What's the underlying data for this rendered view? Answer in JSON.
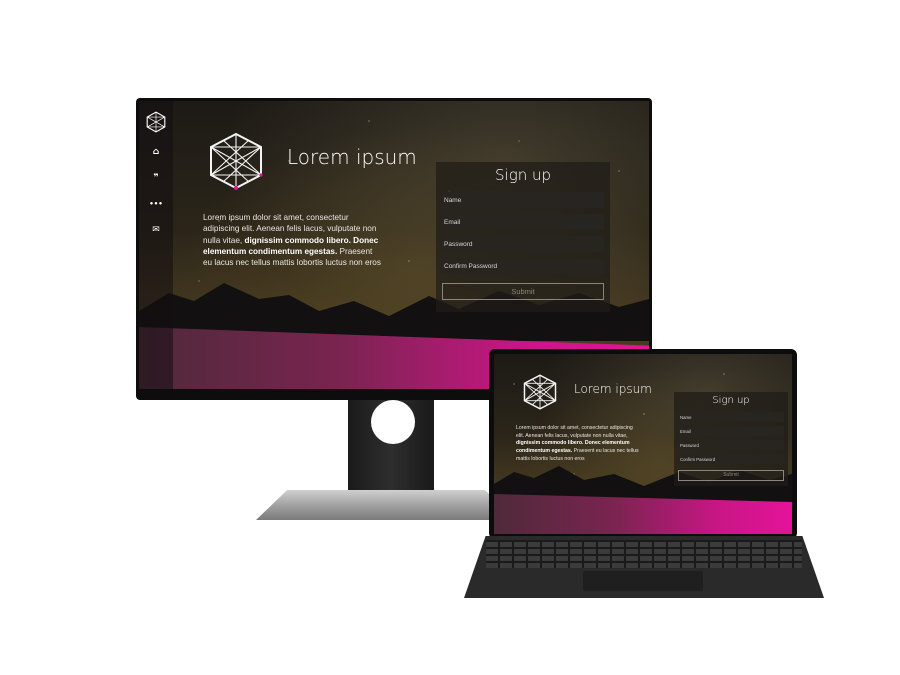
{
  "colors": {
    "accent_magenta": "#e4139a",
    "accent_purple": "#7a2450",
    "sidebar_bg": "#140e12",
    "form_bg": "#1e1c18"
  },
  "sidebar": {
    "items": [
      {
        "icon": "home-icon",
        "glyph": "⌂"
      },
      {
        "icon": "quote-icon",
        "glyph": "❞"
      },
      {
        "icon": "more-icon",
        "glyph": "•••"
      },
      {
        "icon": "mail-icon",
        "glyph": "✉"
      }
    ]
  },
  "hero": {
    "title": "Lorem ipsum",
    "text_1": "Lorem ipsum dolor sit amet, consectetur adipiscing elit. Aenean felis lacus, vulputate non nulla vitae,",
    "text_bold": "dignissim commodo libero. Donec elementum condimentum egestas.",
    "text_2": "Praesent eu lacus nec tellus mattis lobortis luctus non eros"
  },
  "signup": {
    "title": "Sign up",
    "name_label": "Name",
    "email_label": "Email",
    "password_label": "Password",
    "confirm_label": "Confirm Password",
    "submit_label": "Submit"
  }
}
